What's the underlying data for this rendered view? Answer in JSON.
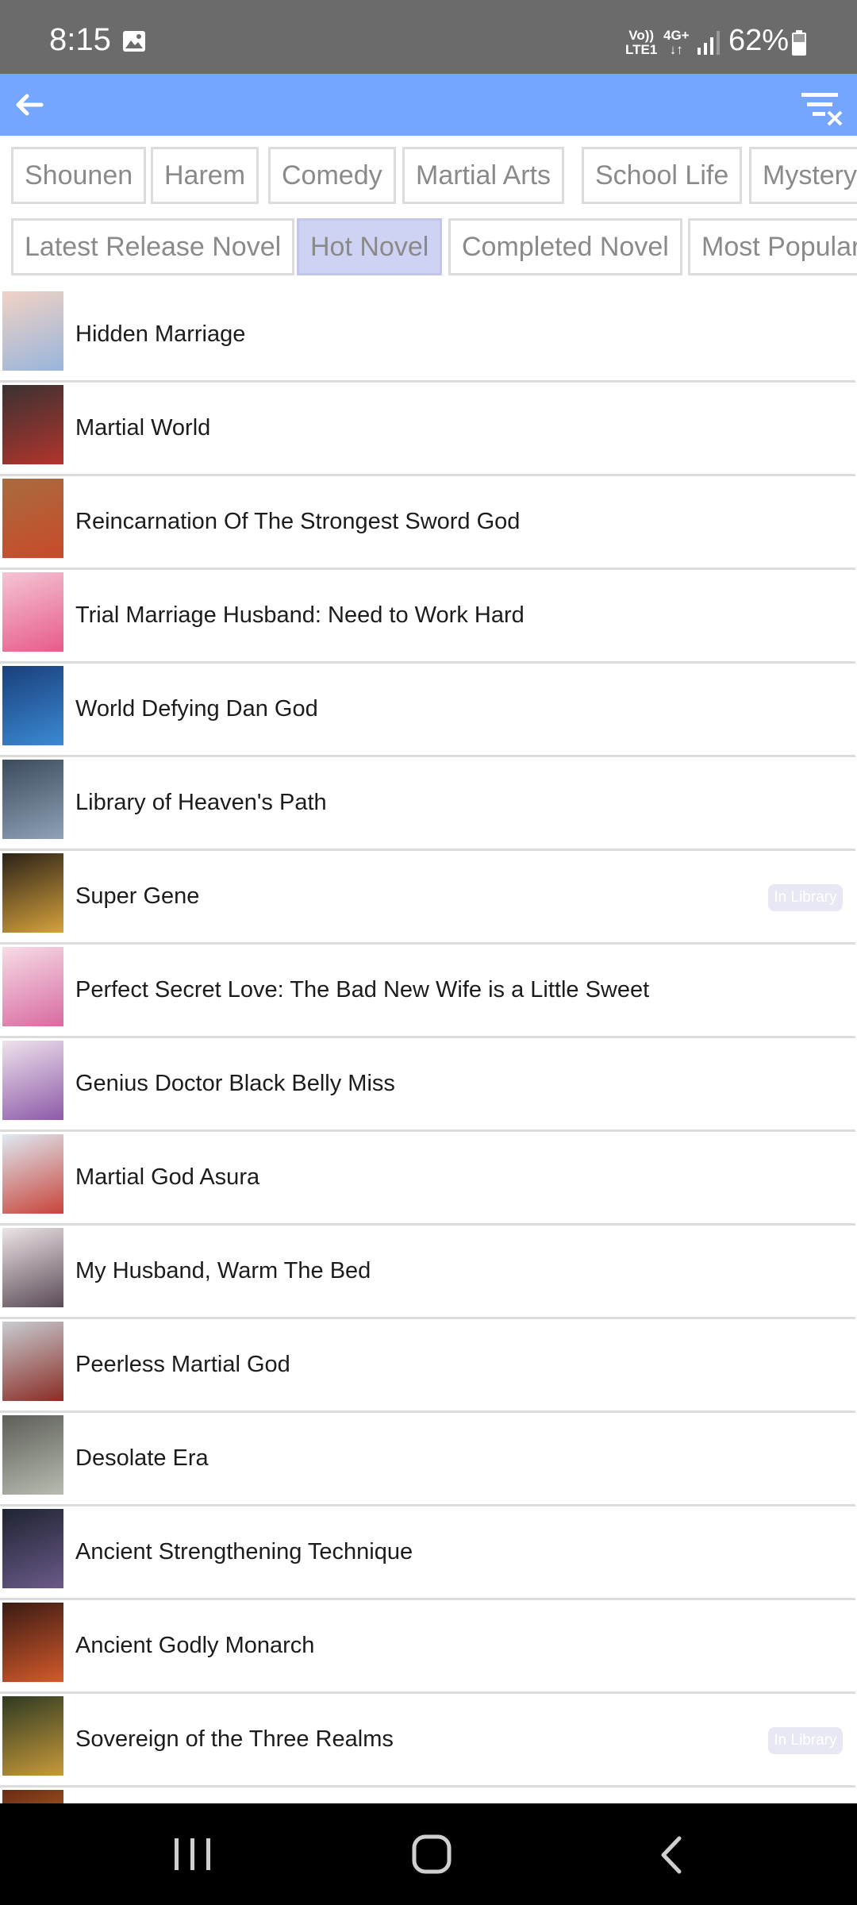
{
  "status_bar": {
    "time": "8:15",
    "volte_top": "Vo))",
    "volte_bottom": "LTE1",
    "network": "4G+",
    "battery": "62%"
  },
  "toolbar": {
    "back_icon": "arrow-left-icon",
    "filter_icon": "filter-clear-icon",
    "color": "#74a6ff"
  },
  "genre_chips": [
    "Shounen",
    "Harem",
    "Comedy",
    "Martial Arts",
    "School Life",
    "Mystery"
  ],
  "list_chips": [
    "Latest Release Novel",
    "Hot Novel",
    "Completed Novel",
    "Most Popular"
  ],
  "selected_list_chip": "Hot Novel",
  "novels": [
    {
      "title": "Hidden Marriage",
      "in_library": false,
      "cover": [
        "#f1d2c4",
        "#98b5dc"
      ]
    },
    {
      "title": "Martial World",
      "in_library": false,
      "cover": [
        "#3a3232",
        "#b2342c"
      ]
    },
    {
      "title": "Reincarnation Of The Strongest Sword God",
      "in_library": false,
      "cover": [
        "#a86c3e",
        "#c84a2a"
      ]
    },
    {
      "title": "Trial Marriage Husband: Need to Work Hard",
      "in_library": false,
      "cover": [
        "#f4c5d4",
        "#e85a8a"
      ]
    },
    {
      "title": "World Defying Dan God",
      "in_library": false,
      "cover": [
        "#1a3f7a",
        "#3a8ad4"
      ]
    },
    {
      "title": "Library of Heaven's Path",
      "in_library": false,
      "cover": [
        "#3c4a5c",
        "#8fa2b8"
      ]
    },
    {
      "title": "Super Gene",
      "in_library": true,
      "cover": [
        "#2b2218",
        "#d6a23c"
      ]
    },
    {
      "title": "Perfect Secret Love: The Bad New Wife is a Little Sweet",
      "in_library": false,
      "cover": [
        "#f6dce6",
        "#d86aa0"
      ]
    },
    {
      "title": "Genius Doctor Black Belly Miss",
      "in_library": false,
      "cover": [
        "#efe2ec",
        "#8c5aa8"
      ]
    },
    {
      "title": "Martial God Asura",
      "in_library": false,
      "cover": [
        "#dfe9f2",
        "#c8443a"
      ]
    },
    {
      "title": "My Husband, Warm The Bed",
      "in_library": false,
      "cover": [
        "#ece4e6",
        "#5a4a56"
      ]
    },
    {
      "title": "Peerless Martial God",
      "in_library": false,
      "cover": [
        "#c8ccd2",
        "#8a2c24"
      ]
    },
    {
      "title": "Desolate Era",
      "in_library": false,
      "cover": [
        "#5c5e58",
        "#b8bcb0"
      ]
    },
    {
      "title": "Ancient Strengthening Technique",
      "in_library": false,
      "cover": [
        "#1f2432",
        "#6a5a88"
      ]
    },
    {
      "title": "Ancient Godly Monarch",
      "in_library": false,
      "cover": [
        "#3a1a14",
        "#d45a2a"
      ]
    },
    {
      "title": "Sovereign of the Three Realms",
      "in_library": true,
      "cover": [
        "#2e3a22",
        "#c89a3a"
      ]
    },
    {
      "title": "",
      "in_library": false,
      "cover": [
        "#6a2a14",
        "#d8842a"
      ]
    }
  ],
  "badge_text": "In Library",
  "nav_bar": {
    "recents_icon": "recents-icon",
    "home_icon": "home-icon",
    "back_icon": "nav-back-icon"
  }
}
